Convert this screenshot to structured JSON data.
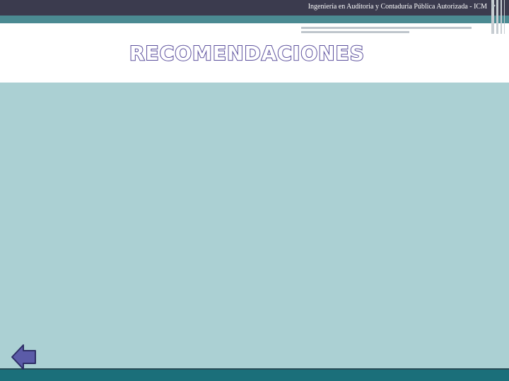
{
  "header": {
    "text": "Ingeniería en Auditoria y Contaduría Pública Autorizada - ICM"
  },
  "slide": {
    "title": "RECOMENDACIONES"
  },
  "navigation": {
    "back_icon": "arrow-left-icon"
  },
  "colors": {
    "top_bar": "#3b3b4e",
    "teal_band": "#4b8a92",
    "content_background": "#abd0d3",
    "bottom_bar": "#1b6f7a",
    "title_outline": "#5b4f9c",
    "arrow_fill": "#5b5ba8"
  }
}
